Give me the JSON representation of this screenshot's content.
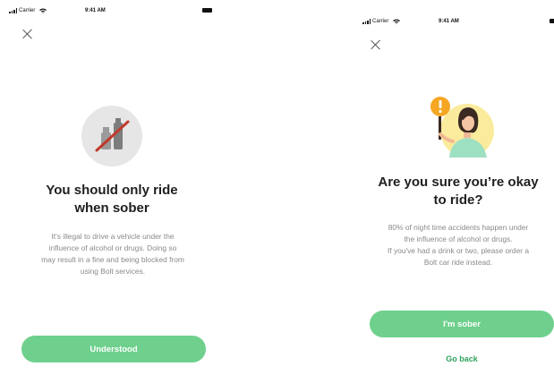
{
  "status_bar": {
    "carrier": "Carrier",
    "time": "9:41 AM"
  },
  "screens": [
    {
      "title_lines": [
        "You should only ride",
        "when sober"
      ],
      "body_lines": [
        "It's illegal to drive a vehicle under the",
        "influence of alcohol or drugs.  Doing so",
        "may result in a fine and being blocked from",
        "using Bolt services."
      ],
      "primary_button": "Understood",
      "icons": {
        "close": "close-icon",
        "illustration": "no-drinks-icon"
      }
    },
    {
      "title_lines": [
        "Are you sure you’re okay",
        "to ride?"
      ],
      "body_lines": [
        "80% of night time accidents happen under",
        "the influence of alcohol or drugs.",
        "If you've had a drink or two, please order a",
        "Bolt car ride instead."
      ],
      "primary_button": "I'm sober",
      "secondary_button": "Go back",
      "icons": {
        "close": "close-icon",
        "illustration": "warning-person-illustration"
      }
    }
  ],
  "colors": {
    "accent": "#6ed08c",
    "link": "#2fa35d",
    "warning": "#f5a623",
    "strike": "#c0392b"
  }
}
